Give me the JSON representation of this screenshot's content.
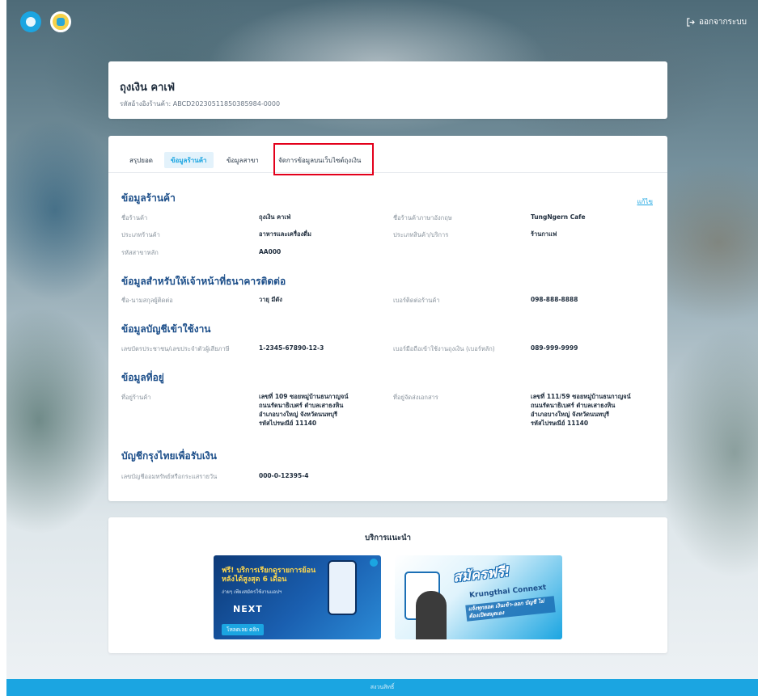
{
  "header": {
    "logout_label": "ออกจากระบบ"
  },
  "shop_header": {
    "name": "ถุงเงิน คาเฟ่",
    "ref_label": "รหัสอ้างอิงร้านค้า:",
    "ref_value": "ABCD20230511850385984-0000"
  },
  "tabs": [
    {
      "label": "สรุปยอด",
      "active": false
    },
    {
      "label": "ข้อมูลร้านค้า",
      "active": true
    },
    {
      "label": "ข้อมูลสาขา",
      "active": false
    },
    {
      "label": "จัดการข้อมูลบนเว็บไซต์ถุงเงิน",
      "active": false
    }
  ],
  "shop_info": {
    "title": "ข้อมูลร้านค้า",
    "edit_label": "แก้ไข",
    "name_label": "ชื่อร้านค้า",
    "name_value": "ถุงเงิน คาเฟ่",
    "name_en_label": "ชื่อร้านค้าภาษาอังกฤษ",
    "name_en_value": "TungNgern Cafe",
    "type_label": "ประเภทร้านค้า",
    "type_value": "อาหารและเครื่องดื่ม",
    "product_type_label": "ประเภทสินค้า/บริการ",
    "product_type_value": "ร้านกาแฟ",
    "branch_code_label": "รหัสสาขาหลัก",
    "branch_code_value": "AA000"
  },
  "contact_info": {
    "title": "ข้อมูลสำหรับให้เจ้าหน้าที่ธนาคารติดต่อ",
    "person_label": "ชื่อ-นามสกุลผู้ติดต่อ",
    "person_value": "วายุ มีดัง",
    "phone_label": "เบอร์ติดต่อร้านค้า",
    "phone_value": "098-888-8888"
  },
  "account_info": {
    "title": "ข้อมูลบัญชีเข้าใช้งาน",
    "id_label": "เลขบัตรประชาชน/เลขประจำตัวผู้เสียภาษี",
    "id_value": "1-2345-67890-12-3",
    "mobile_label": "เบอร์มือถือเข้าใช้งานถุงเงิน (เบอร์หลัก)",
    "mobile_value": "089-999-9999"
  },
  "address_info": {
    "title": "ข้อมูลที่อยู่",
    "shop_addr_label": "ที่อยู่ร้านค้า",
    "shop_addr_lines": [
      "เลขที่ 109 ซอยหมู่บ้านธนกาญจน์",
      "ถนนรัตนาธิเบศร์ ตำบลเสาธงหิน",
      "อำเภอบางใหญ่ จังหวัดนนทบุรี",
      "รหัสไปรษณีย์ 11140"
    ],
    "doc_addr_label": "ที่อยู่จัดส่งเอกสาร",
    "doc_addr_lines": [
      "เลขที่ 111/59 ซอยหมู่บ้านธนกาญจน์",
      "ถนนรัตนาธิเบศร์ ตำบลเสาธงหิน",
      "อำเภอบางใหญ่ จังหวัดนนทบุรี",
      "รหัสไปรษณีย์ 11140"
    ]
  },
  "bank_info": {
    "title": "บัญชีกรุงไทยเพื่อรับเงิน",
    "account_label": "เลขบัญชีออมทรัพย์หรือกระแสรายวัน",
    "account_value": "000-0-12395-4"
  },
  "services": {
    "title": "บริการแนะนำ",
    "banner1": {
      "headline": "ฟรี! บริการเรียกดูรายการย้อนหลังได้สูงสุด 6 เดือน",
      "sub": "ง่ายๆ เพียงสมัครใช้งานแอปฯ",
      "brand": "NEXT",
      "button": "โหลดเลย คลิก"
    },
    "banner2": {
      "headline": "สมัครฟรี!",
      "brand": "Krungthai Connext",
      "desc": "แจ้งทุกยอด เงินเข้า-ออก บัญชี ไม่ต้องเปิดสมุดเอง"
    }
  },
  "footer": {
    "text": "สงวนสิทธิ์"
  }
}
